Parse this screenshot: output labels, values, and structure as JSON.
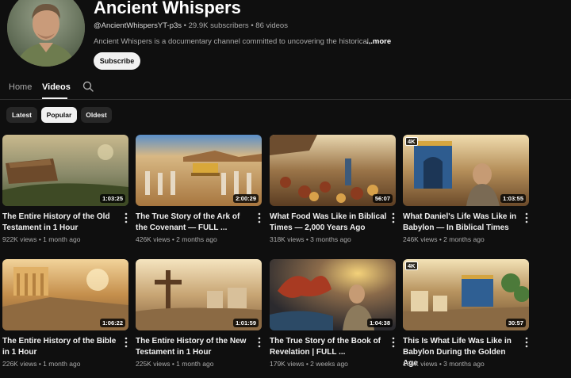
{
  "channel": {
    "name": "Ancient Whispers",
    "handle": "@AncientWhispersYT-p3s",
    "stats": "• 29.9K subscribers • 86 videos",
    "description": "Ancient Whispers is a documentary channel committed to uncovering the historical,",
    "more_label": "...more",
    "subscribe_label": "Subscribe"
  },
  "tabs": [
    {
      "label": "Home",
      "active": false
    },
    {
      "label": "Videos",
      "active": true
    }
  ],
  "search_icon": "search-icon",
  "chips": [
    {
      "label": "Latest",
      "active": false
    },
    {
      "label": "Popular",
      "active": true
    },
    {
      "label": "Oldest",
      "active": false
    }
  ],
  "videos": [
    {
      "title": "The Entire History of the Old Testament in 1 Hour",
      "views": "922K views",
      "age": "1 month ago",
      "duration": "1:03:25",
      "badge": ""
    },
    {
      "title": "The True Story of the Ark of the Covenant — FULL ...",
      "views": "426K views",
      "age": "2 months ago",
      "duration": "2:00:29",
      "badge": ""
    },
    {
      "title": "What Food Was Like in Biblical Times — 2,000 Years Ago",
      "views": "318K views",
      "age": "3 months ago",
      "duration": "56:07",
      "badge": ""
    },
    {
      "title": "What Daniel's Life Was Like in Babylon — In Biblical Times",
      "views": "246K views",
      "age": "2 months ago",
      "duration": "1:03:55",
      "badge": "4K"
    },
    {
      "title": "The Entire History of the Bible in 1 Hour",
      "views": "226K views",
      "age": "1 month ago",
      "duration": "1:06:22",
      "badge": ""
    },
    {
      "title": "The Entire History of the New Testament in 1 Hour",
      "views": "225K views",
      "age": "1 month ago",
      "duration": "1:01:59",
      "badge": ""
    },
    {
      "title": "The True Story of the Book of Revelation | FULL ...",
      "views": "179K views",
      "age": "2 weeks ago",
      "duration": "1:04:38",
      "badge": ""
    },
    {
      "title": "This Is What Life Was Like in Babylon During the Golden Age",
      "views": "166K views",
      "age": "3 months ago",
      "duration": "30:57",
      "badge": "4K"
    }
  ]
}
